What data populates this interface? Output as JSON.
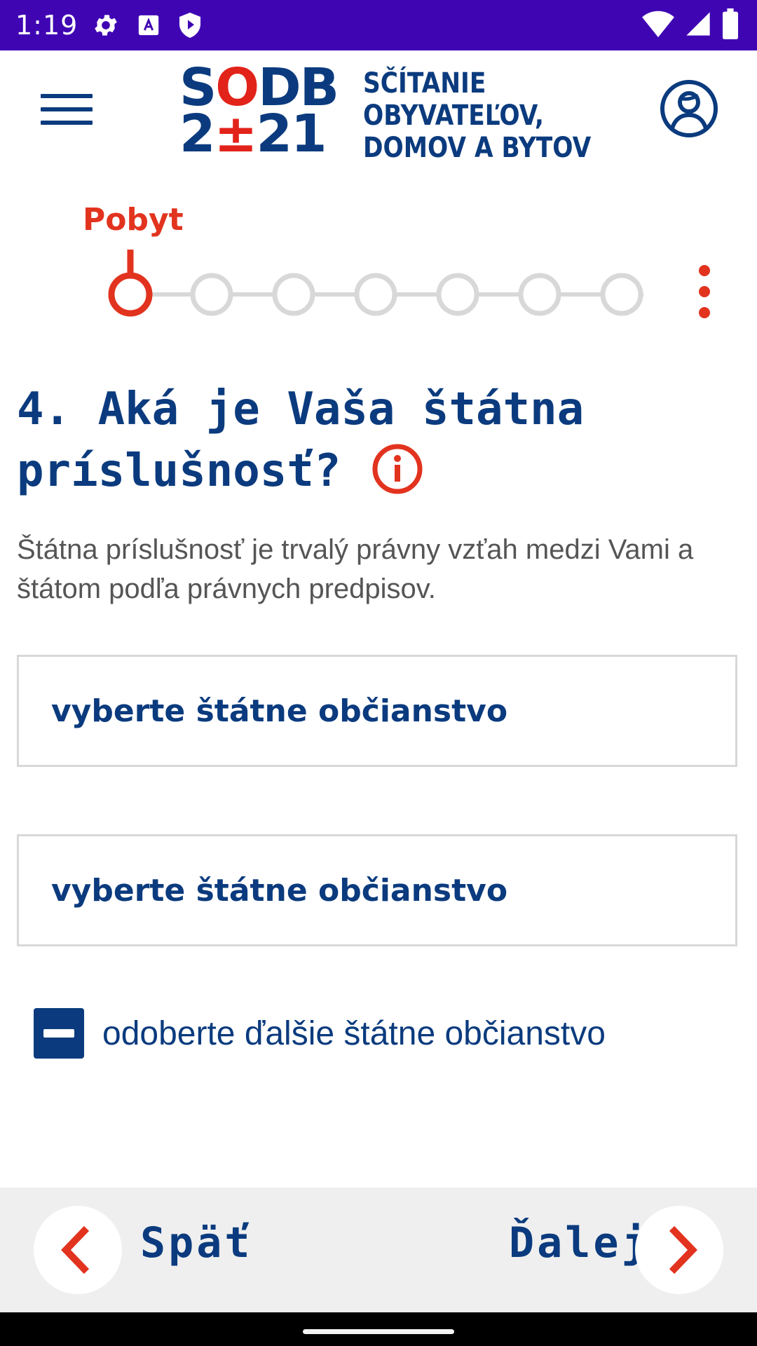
{
  "status_bar": {
    "time": "1:19",
    "left_icons": [
      "settings-icon",
      "text-app-icon",
      "shield-play-icon"
    ],
    "right_icons": [
      "wifi-icon",
      "signal-icon",
      "battery-icon"
    ],
    "background": "#3f05b3"
  },
  "header": {
    "logo": {
      "mark_top": "SODB",
      "mark_bottom": "2±21",
      "text_line1": "SČÍTANIE",
      "text_line2": "OBYVATEĽOV,",
      "text_line3": "DOMOV A BYTOV"
    },
    "menu_icon": "hamburger-menu-icon",
    "profile_icon": "user-profile-icon"
  },
  "stepper": {
    "current_label": "Pobyt",
    "total_steps": 7,
    "current_step": 1,
    "more_icon": "more-vertical-icon"
  },
  "question": {
    "title": "4. Aká je Vaša štátna príslušnosť?",
    "info_icon": "info-icon",
    "description": "Štátna príslušnosť je trvalý právny vzťah medzi Vami a štátom podľa právnych predpisov."
  },
  "selects": [
    {
      "placeholder": "vyberte štátne občianstvo"
    },
    {
      "placeholder": "vyberte štátne občianstvo"
    }
  ],
  "remove_action": {
    "label": "odoberte ďalšie štátne občianstvo",
    "icon": "minus-square-icon"
  },
  "navigation": {
    "back_label": "Späť",
    "next_label": "Ďalej",
    "back_icon": "chevron-left-icon",
    "next_icon": "chevron-right-icon"
  },
  "colors": {
    "brand_blue": "#0b3b7e",
    "accent_red": "#e2331f",
    "inactive_step": "#d8d8d8"
  }
}
